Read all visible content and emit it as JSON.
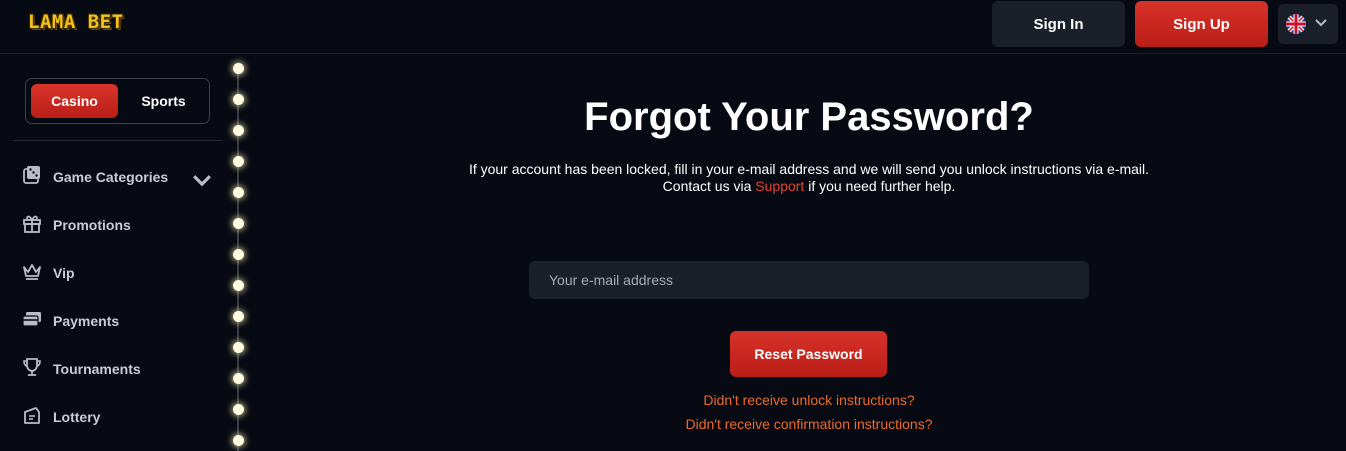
{
  "header": {
    "logo_text": "LAMA BET",
    "signin_label": "Sign In",
    "signup_label": "Sign Up",
    "language_icon": "uk-flag-icon"
  },
  "sidebar": {
    "switch": {
      "casino_label": "Casino",
      "sports_label": "Sports",
      "active": "Casino"
    },
    "items": [
      {
        "label": "Game Categories",
        "icon": "dice-icon"
      },
      {
        "label": "Promotions",
        "icon": "gift-icon"
      },
      {
        "label": "Vip",
        "icon": "crown-icon"
      },
      {
        "label": "Payments",
        "icon": "cards-icon"
      },
      {
        "label": "Tournaments",
        "icon": "trophy-icon"
      },
      {
        "label": "Lottery",
        "icon": "ticket-icon"
      }
    ]
  },
  "main": {
    "title": "Forgot Your Password?",
    "description_line1": "If your account has been locked, fill in your e-mail address and we will send you unlock instructions via e-mail.",
    "description_line2_before": "Contact us via",
    "support_link": "Support",
    "description_line2_after": "if you need further help.",
    "email_placeholder": "Your e-mail address",
    "reset_button": "Reset Password",
    "link_unlock": "Didn't receive unlock instructions?",
    "link_confirmation": "Didn't receive confirmation instructions?"
  },
  "colors": {
    "background": "#070a12",
    "accent_red": "#d7322a",
    "link_orange": "#ec6a2c",
    "logo_yellow": "#f3c11b"
  }
}
